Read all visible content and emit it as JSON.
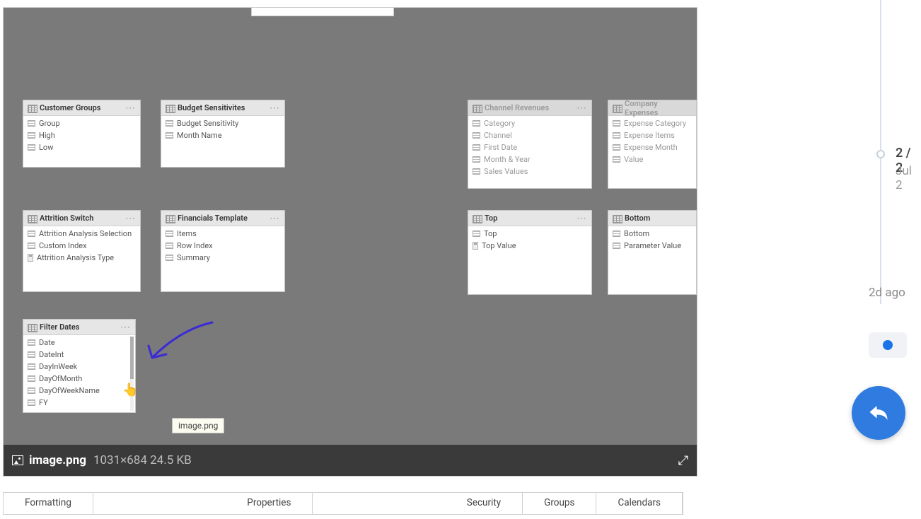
{
  "tables": {
    "customerGroups": {
      "title": "Customer Groups",
      "fields": [
        "Group",
        "High",
        "Low"
      ]
    },
    "budgetSensitivities": {
      "title": "Budget Sensitivites",
      "fields": [
        "Budget Sensitivity",
        "Month Name"
      ]
    },
    "channelRevenues": {
      "title": "Channel Revenues",
      "fields": [
        "Category",
        "Channel",
        "First Date",
        "Month & Year",
        "Sales Values"
      ]
    },
    "companyExpenses": {
      "title": "Company Expenses",
      "fields": [
        "Expense Category",
        "Expense Items",
        "Expense Month",
        "Value"
      ]
    },
    "attritionSwitch": {
      "title": "Attrition Switch",
      "fields": [
        "Attrition Analysis Selection",
        "Custom Index",
        "Attrition Analysis Type"
      ],
      "calc": [
        false,
        false,
        true
      ]
    },
    "financialsTemplate": {
      "title": "Financials Template",
      "fields": [
        "Items",
        "Row Index",
        "Summary"
      ]
    },
    "top": {
      "title": "Top",
      "fields": [
        "Top",
        "Top Value"
      ],
      "calc": [
        false,
        true
      ]
    },
    "bottom": {
      "title": "Bottom",
      "fields": [
        "Bottom",
        "Parameter Value"
      ]
    },
    "filterDates": {
      "title": "Filter Dates",
      "fields": [
        "Date",
        "DateInt",
        "DayInWeek",
        "DayOfMonth",
        "DayOfWeekName",
        "FY"
      ]
    }
  },
  "tooltip": "image.png",
  "footer": {
    "filename": "image.png",
    "dimensions": "1031×684 24.5 KB"
  },
  "tabs": [
    "Formatting",
    "Properties",
    "Security",
    "Groups",
    "Calendars"
  ],
  "timeline": {
    "counter": "2 / 2",
    "sub": "Jul 2",
    "ago": "2d ago"
  }
}
